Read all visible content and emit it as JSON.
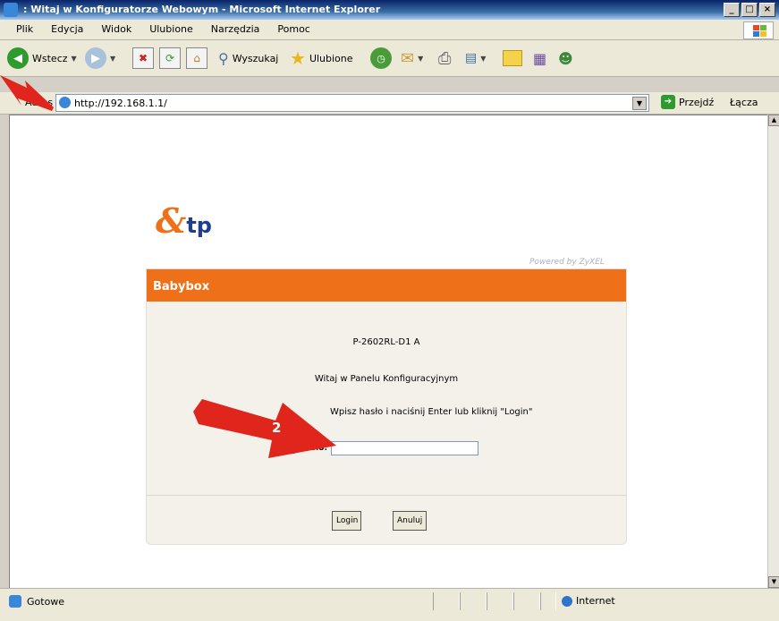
{
  "window": {
    "title": ": Witaj w Konfiguratorze Webowym - Microsoft Internet Explorer",
    "btn_min": "_",
    "btn_max": "□",
    "btn_close": "×"
  },
  "menu": [
    "Plik",
    "Edycja",
    "Widok",
    "Ulubione",
    "Narzędzia",
    "Pomoc"
  ],
  "toolbar": {
    "back_label": "Wstecz",
    "search_label": "Wyszukaj",
    "favorites_label": "Ulubione"
  },
  "address": {
    "label": "Adres",
    "url": "http://192.168.1.1/",
    "go_label": "Przejdź",
    "links_label": "Łącza"
  },
  "page": {
    "logo_letter": "&",
    "logo_text": "tp",
    "powered": "Powered by ZyXEL",
    "panel_title": "Babybox",
    "model": "P-2602RL-D1 A",
    "welcome": "Witaj w Panelu Konfiguracyjnym",
    "instruction": "Wpisz hasło i naciśnij Enter lub kliknij \"Login\"",
    "password_label": "Hasło:",
    "password_value": "",
    "login_button": "Login",
    "cancel_button": "Anuluj"
  },
  "annotations": {
    "arrow2_label": "2"
  },
  "status": {
    "text": "Gotowe",
    "zone": "Internet"
  },
  "colors": {
    "accent_orange": "#ee7018",
    "annotation_red": "#e0261c"
  }
}
